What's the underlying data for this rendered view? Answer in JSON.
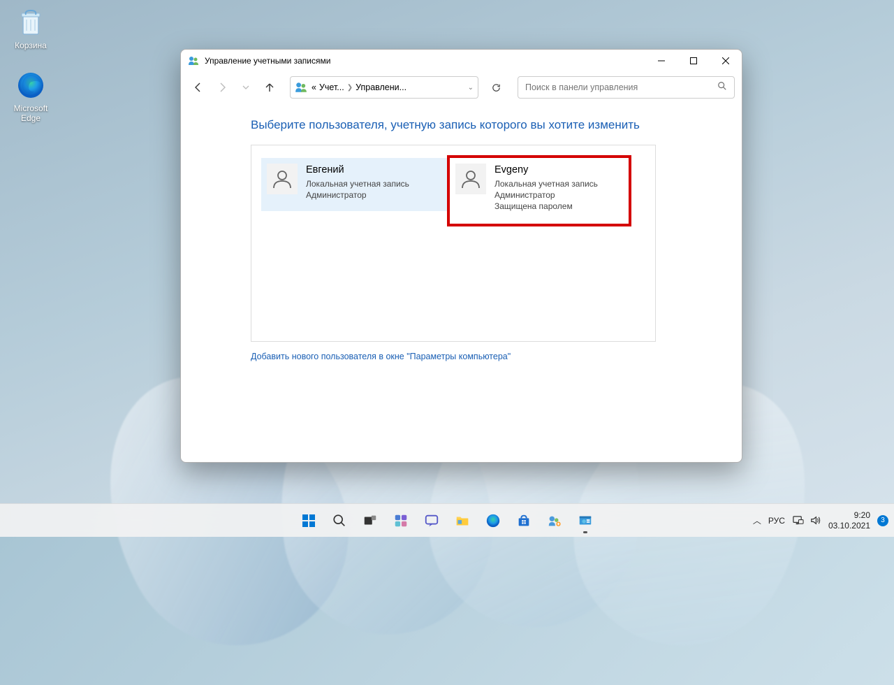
{
  "desktop": {
    "recycle_bin": "Корзина",
    "edge": "Microsoft Edge"
  },
  "window": {
    "title": "Управление учетными записями",
    "breadcrumb": {
      "prefix": "«",
      "p1": "Учет...",
      "p2": "Управлени..."
    },
    "search_placeholder": "Поиск в панели управления",
    "heading": "Выберите пользователя, учетную запись которого вы хотите изменить",
    "users": [
      {
        "name": "Евгений",
        "line1": "Локальная учетная запись",
        "line2": "Администратор",
        "line3": ""
      },
      {
        "name": "Evgeny",
        "line1": "Локальная учетная запись",
        "line2": "Администратор",
        "line3": "Защищена паролем"
      }
    ],
    "add_link": "Добавить нового пользователя в окне \"Параметры компьютера\""
  },
  "taskbar": {
    "lang": "РУС",
    "time": "9:20",
    "date": "03.10.2021",
    "notif": "3"
  }
}
